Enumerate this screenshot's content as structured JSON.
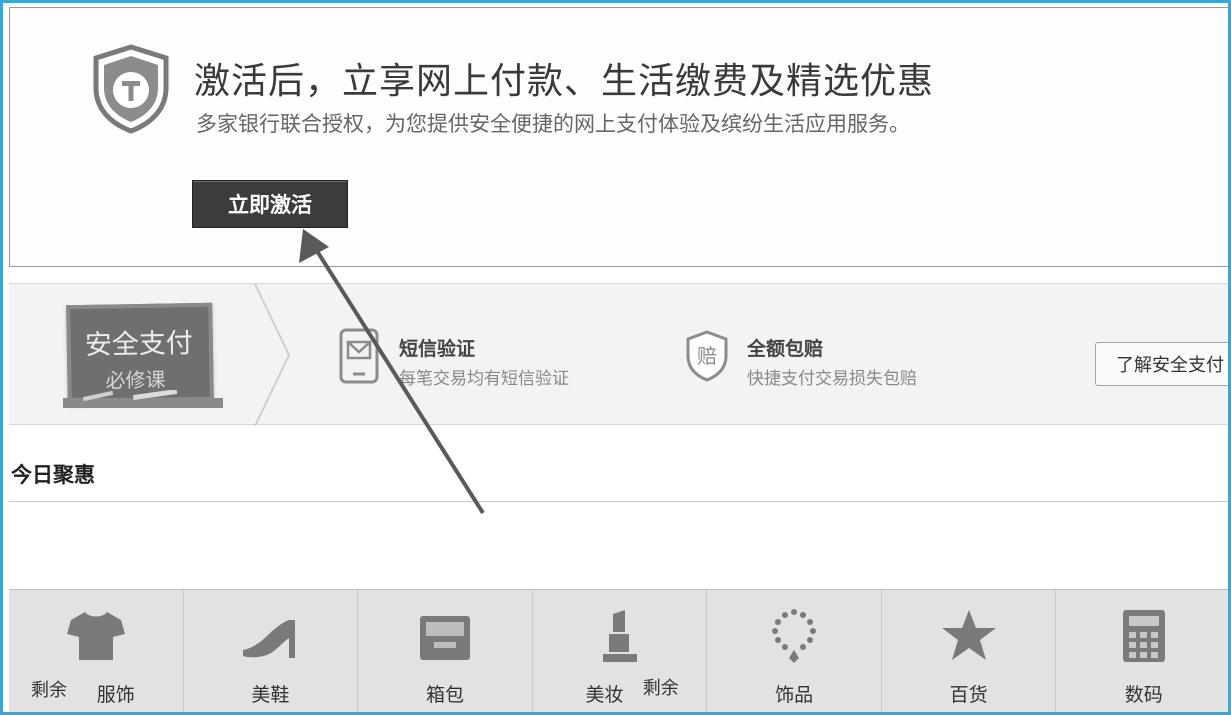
{
  "activation": {
    "title": "激活后，立享网上付款、生活缴费及精选优惠",
    "subtitle": "多家银行联合授权，为您提供安全便捷的网上支付体验及缤纷生活应用服务。",
    "button_label": "立即激活"
  },
  "security": {
    "board_line1": "安全支付",
    "board_line2": "必修课",
    "features": [
      {
        "icon": "sms-phone-icon",
        "title": "短信验证",
        "desc": "每笔交易均有短信验证"
      },
      {
        "icon": "compensation-shield-icon",
        "icon_char": "赔",
        "title": "全额包赔",
        "desc": "快捷支付交易损失包赔"
      }
    ],
    "learn_button": "了解安全支付"
  },
  "deals": {
    "title": "今日聚惠"
  },
  "categories": {
    "items": [
      {
        "label": "服饰",
        "icon": "tshirt-icon"
      },
      {
        "label": "美鞋",
        "icon": "high-heel-icon"
      },
      {
        "label": "箱包",
        "icon": "bag-icon"
      },
      {
        "label": "美妆",
        "icon": "lipstick-icon"
      },
      {
        "label": "饰品",
        "icon": "necklace-icon"
      },
      {
        "label": "百货",
        "icon": "star-icon"
      },
      {
        "label": "数码",
        "icon": "calculator-icon"
      }
    ],
    "extra_1": "剩余",
    "extra_2": "剩余"
  },
  "colors": {
    "frame_border": "#35a8d6",
    "button_dark": "#3c3c3c",
    "icon_gray": "#7a7a7a"
  }
}
